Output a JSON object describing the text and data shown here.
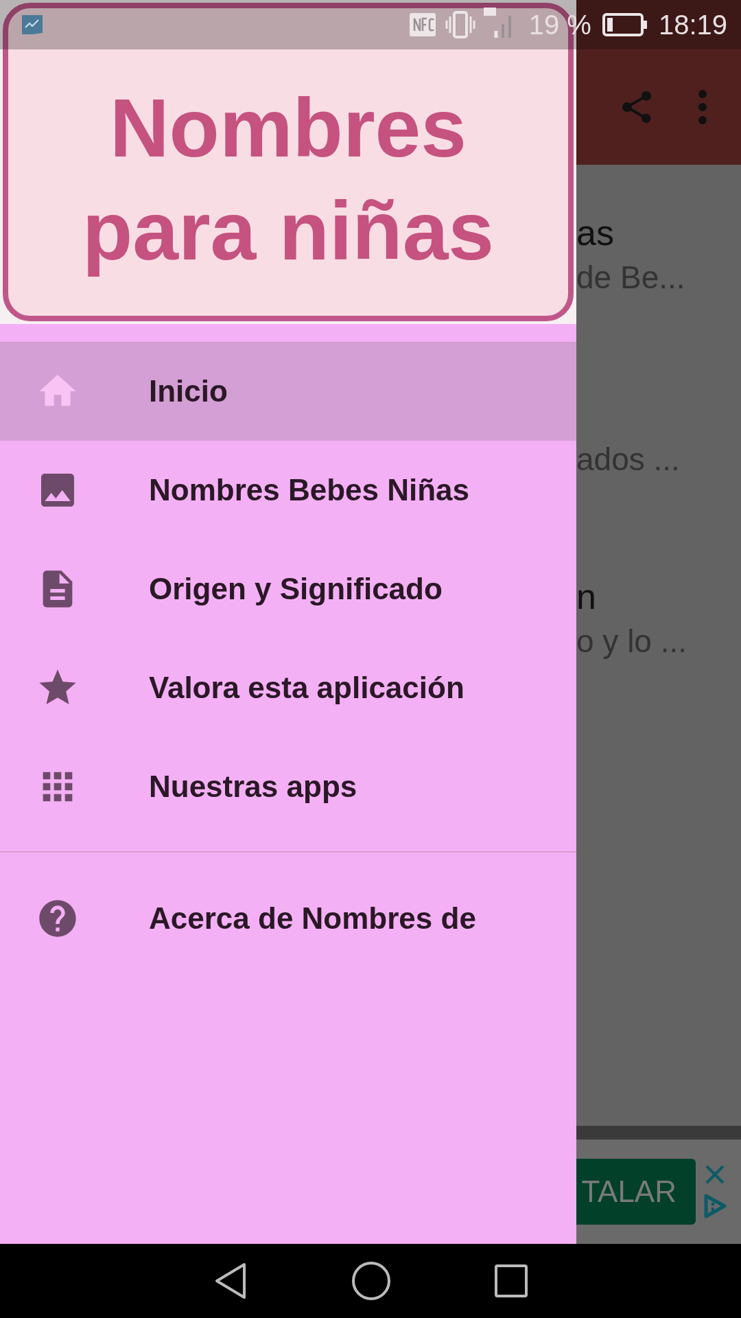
{
  "status_bar": {
    "battery_text": "19 %",
    "time": "18:19"
  },
  "background_list": [
    {
      "title": "as",
      "subtitle": "de Be..."
    },
    {
      "subtitle": "ados ..."
    },
    {
      "title": "n",
      "subtitle": "o y lo ..."
    }
  ],
  "ad": {
    "button": "TALAR"
  },
  "drawer": {
    "header_lines": [
      "Nombres",
      "para niñas"
    ],
    "items": [
      {
        "kind": "home",
        "label": "Inicio",
        "selected": true
      },
      {
        "kind": "image",
        "label": "Nombres Bebes Niñas",
        "selected": false
      },
      {
        "kind": "document",
        "label": "Origen y Significado",
        "selected": false
      },
      {
        "kind": "star",
        "label": "Valora esta aplicación",
        "selected": false
      },
      {
        "kind": "apps",
        "label": "Nuestras apps",
        "selected": false
      }
    ],
    "footer_items": [
      {
        "kind": "help",
        "label": "Acerca de Nombres de",
        "selected": false
      }
    ]
  }
}
